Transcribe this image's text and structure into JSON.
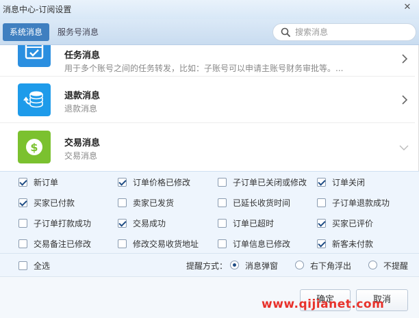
{
  "window": {
    "title": "消息中心-订阅设置"
  },
  "tabs": [
    {
      "label": "系统消息",
      "active": true
    },
    {
      "label": "服务号消息",
      "active": false
    }
  ],
  "search": {
    "placeholder": "搜索消息",
    "value": ""
  },
  "messages": [
    {
      "name": "任务消息",
      "desc": "用于多个账号之间的任务转发，比如：子账号可以申请主账号财务审批等。...",
      "icon": "calendar-check-icon",
      "color": "#2b8fe0",
      "expanded": false
    },
    {
      "name": "退款消息",
      "desc": "退款消息",
      "icon": "coins-refund-icon",
      "color": "#1e9bea",
      "expanded": false
    },
    {
      "name": "交易消息",
      "desc": "交易消息",
      "icon": "dollar-coin-icon",
      "color": "#7bc12f",
      "expanded": true
    }
  ],
  "options": [
    {
      "label": "新订单",
      "checked": true
    },
    {
      "label": "订单价格已修改",
      "checked": true
    },
    {
      "label": "子订单已关闭或修改",
      "checked": false
    },
    {
      "label": "订单关闭",
      "checked": true
    },
    {
      "label": "买家已付款",
      "checked": true
    },
    {
      "label": "卖家已发货",
      "checked": false
    },
    {
      "label": "已延长收货时间",
      "checked": false
    },
    {
      "label": "子订单退款成功",
      "checked": false
    },
    {
      "label": "子订单打款成功",
      "checked": false
    },
    {
      "label": "交易成功",
      "checked": true
    },
    {
      "label": "订单已超时",
      "checked": false
    },
    {
      "label": "买家已评价",
      "checked": true
    },
    {
      "label": "交易备注已修改",
      "checked": false
    },
    {
      "label": "修改交易收货地址",
      "checked": false
    },
    {
      "label": "订单信息已修改",
      "checked": false
    },
    {
      "label": "新客未付款",
      "checked": true
    }
  ],
  "select_all": {
    "label": "全选",
    "checked": false
  },
  "remind": {
    "label": "提醒方式：",
    "options": [
      {
        "label": "消息弹窗",
        "selected": true
      },
      {
        "label": "右下角浮出",
        "selected": false
      },
      {
        "label": "不提醒",
        "selected": false
      }
    ]
  },
  "buttons": {
    "ok": "确定",
    "cancel": "取消"
  },
  "watermark": "www.qijianet.com",
  "colors": {
    "accent": "#3f7fc0",
    "panel": "#eef5fd",
    "watermark": "#e8322b"
  }
}
